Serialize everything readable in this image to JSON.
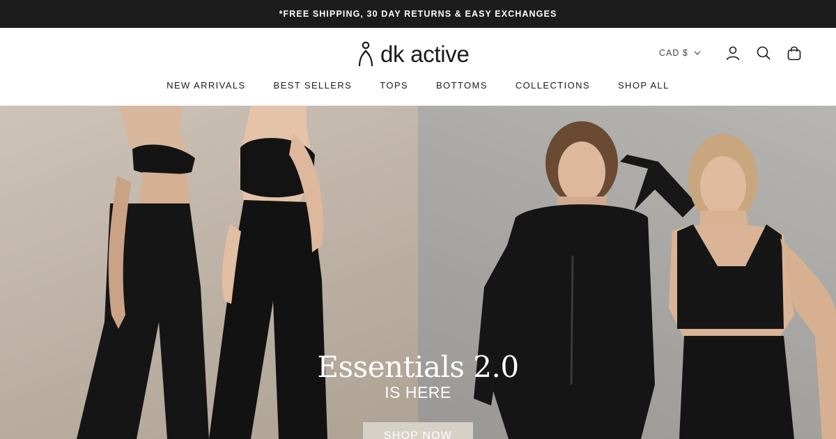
{
  "announcement": "*FREE SHIPPING, 30 DAY RETURNS & EASY EXCHANGES",
  "brand": {
    "name": "dk active"
  },
  "header": {
    "currency": "CAD $",
    "icons": [
      "account-icon",
      "search-icon",
      "cart-icon"
    ]
  },
  "nav": {
    "items": [
      "NEW ARRIVALS",
      "BEST SELLERS",
      "TOPS",
      "BOTTOMS",
      "COLLECTIONS",
      "SHOP ALL"
    ]
  },
  "hero": {
    "title": "Essentials 2.0",
    "subtitle": "IS HERE",
    "cta": "SHOP NOW"
  },
  "colors": {
    "announcement_bg": "#1c1c1c",
    "cta_bg": "#d6d1c6"
  }
}
